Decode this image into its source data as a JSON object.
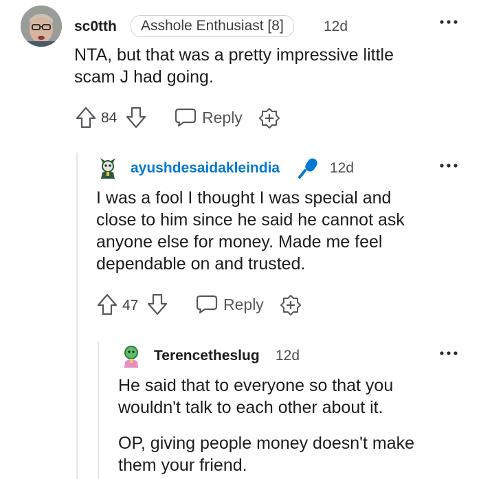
{
  "comments": [
    {
      "username": "sc0tth",
      "flair": "Asshole Enthusiast [8]",
      "age": "12d",
      "body": [
        "NTA, but that was a pretty impressive little",
        "scam J had going."
      ],
      "votes": "84",
      "reply_label": "Reply"
    },
    {
      "username": "ayushdesaidakleindia",
      "age": "12d",
      "body": [
        "I was a fool I thought I was special and",
        "close to him since he said he cannot ask",
        "anyone else for money. Made me feel",
        "dependable on and trusted."
      ],
      "votes": "47",
      "reply_label": "Reply"
    },
    {
      "username": "Terencetheslug",
      "age": "12d",
      "body": [
        "He said that to everyone so that you",
        "wouldn't talk to each other about it.",
        "OP, giving people money doesn't make",
        "them your friend."
      ]
    }
  ],
  "colors": {
    "op_username": "#0079d3",
    "mic_badge": "#0079d3",
    "thread_line": "#e4e6e8"
  }
}
